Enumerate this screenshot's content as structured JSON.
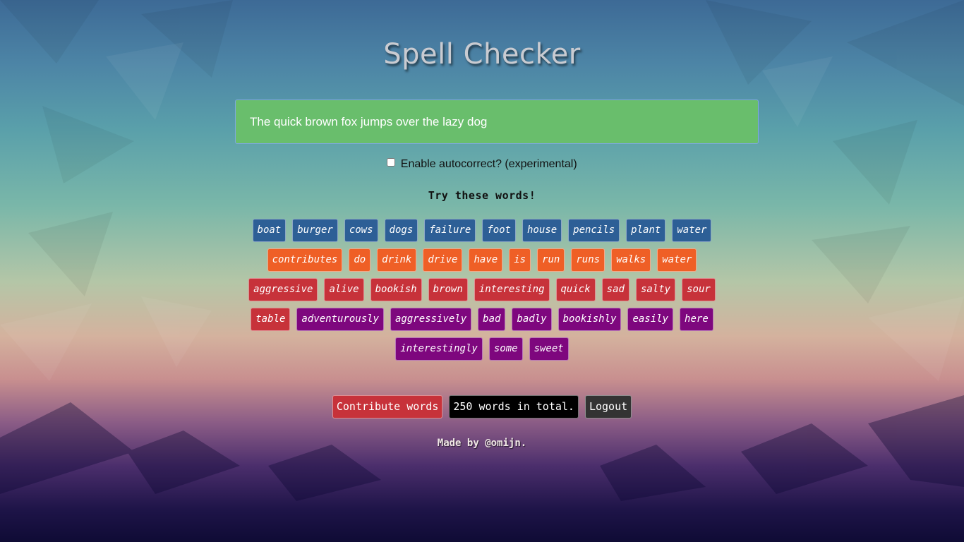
{
  "app": {
    "title": "Spell Checker"
  },
  "input": {
    "value": "The quick brown fox jumps over the lazy dog"
  },
  "autocorrect": {
    "label": "Enable autocorrect? (experimental)",
    "checked": false
  },
  "suggestions": {
    "heading": "Try these words!",
    "rows": [
      {
        "color": "#2d5f96",
        "words": [
          "boat",
          "burger",
          "cows",
          "dogs",
          "failure",
          "foot",
          "house",
          "pencils",
          "plant",
          "water"
        ]
      },
      {
        "color": "#ef5f26",
        "words": [
          "contributes",
          "do",
          "drink",
          "drive",
          "have",
          "is",
          "run",
          "runs",
          "walks",
          "water"
        ]
      },
      {
        "color": "#c7323a",
        "words": [
          "aggressive",
          "alive",
          "bookish",
          "brown",
          "interesting",
          "quick",
          "sad",
          "salty",
          "sour"
        ]
      },
      {
        "color": "#c7323a",
        "words": [
          "table"
        ]
      },
      {
        "color": "#7e077e",
        "words": [
          "adventurously",
          "aggressively",
          "bad",
          "badly",
          "bookishly",
          "easily",
          "here",
          "interestingly",
          "some",
          "sweet"
        ]
      }
    ]
  },
  "footer": {
    "contribute_label": "Contribute words",
    "count_label": "250 words in total.",
    "logout_label": "Logout",
    "credit_prefix": "Made by ",
    "credit_handle": "@omijn",
    "credit_suffix": "."
  },
  "colors": {
    "input_bg": "#69be6c",
    "noun": "#2d5f96",
    "verb": "#ef5f26",
    "adjective": "#c7323a",
    "adverb": "#7e077e"
  }
}
